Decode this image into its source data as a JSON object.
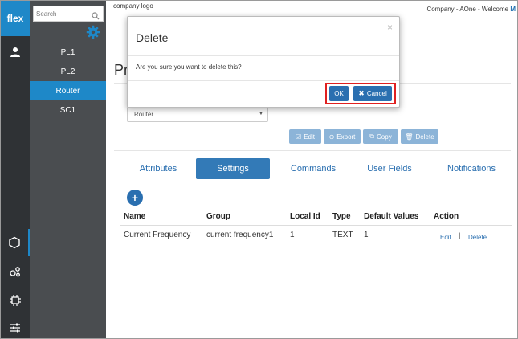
{
  "rail": {
    "logo": "flex"
  },
  "nav": {
    "search_placeholder": "Search",
    "items": [
      "PL1",
      "PL2",
      "Router",
      "SC1"
    ]
  },
  "header": {
    "company_logo": "company logo",
    "welcome_prefix": "Company - AOne - Welcome ",
    "welcome_user": "M"
  },
  "page": {
    "title_fragment": "Pr",
    "select_value": "Router",
    "toolbar": {
      "edit": "Edit",
      "export": "Export",
      "copy": "Copy",
      "delete": "Delete"
    },
    "tabs": [
      "Attributes",
      "Settings",
      "Commands",
      "User Fields",
      "Notifications"
    ],
    "active_tab": "Settings",
    "table": {
      "headers": [
        "Name",
        "Group",
        "Local Id",
        "Type",
        "Default Values",
        "Action"
      ],
      "rows": [
        {
          "name": "Current Frequency",
          "group": "current frequency1",
          "local_id": "1",
          "type": "TEXT",
          "default_values": "1",
          "edit": "Edit",
          "separator": "|",
          "delete": "Delete"
        }
      ]
    }
  },
  "modal": {
    "title": "Delete",
    "close": "×",
    "message": "Are you sure you want to delete this?",
    "ok": "OK",
    "cancel": "Cancel"
  },
  "colors": {
    "accent": "#1e88c8",
    "button": "#2a6fb0",
    "highlight": "#e02020",
    "rail": "#2f3235",
    "nav": "#4a4d50"
  }
}
